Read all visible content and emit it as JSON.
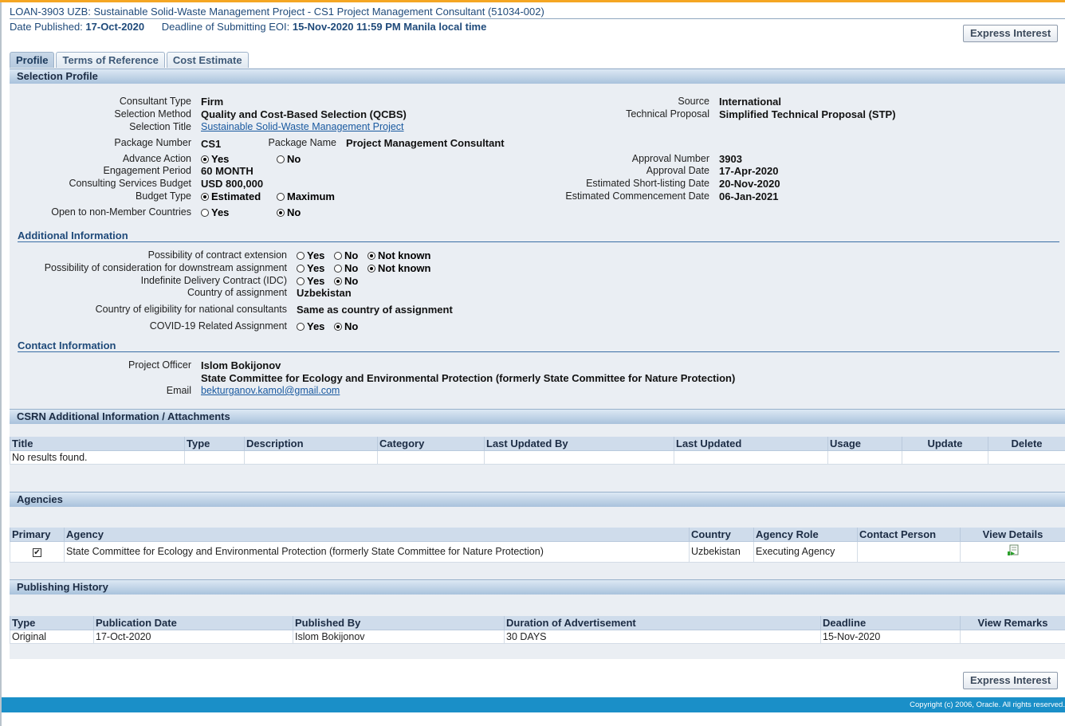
{
  "header": {
    "title": "LOAN-3903 UZB: Sustainable Solid-Waste Management Project - CS1 Project Management Consultant (51034-002)",
    "date_published_label": "Date Published:",
    "date_published": "17-Oct-2020",
    "deadline_label": "Deadline of Submitting EOI:",
    "deadline": "15-Nov-2020 11:59 PM Manila local time",
    "express_interest": "Express Interest"
  },
  "tabs": [
    "Profile",
    "Terms of Reference",
    "Cost Estimate"
  ],
  "selection_profile": {
    "heading": "Selection Profile",
    "consultant_type_label": "Consultant Type",
    "consultant_type": "Firm",
    "selection_method_label": "Selection Method",
    "selection_method": "Quality and Cost-Based Selection (QCBS)",
    "selection_title_label": "Selection Title",
    "selection_title": "Sustainable Solid-Waste Management Project",
    "package_number_label": "Package Number",
    "package_number": "CS1",
    "package_name_label": "Package Name",
    "package_name": "Project Management Consultant",
    "advance_action_label": "Advance Action",
    "yes": "Yes",
    "no": "No",
    "engagement_period_label": "Engagement Period",
    "engagement_period": "60 MONTH",
    "budget_label": "Consulting Services Budget",
    "budget": "USD 800,000",
    "budget_type_label": "Budget Type",
    "estimated": "Estimated",
    "maximum": "Maximum",
    "open_label": "Open to non-Member Countries",
    "source_label": "Source",
    "source": "International",
    "technical_proposal_label": "Technical Proposal",
    "technical_proposal": "Simplified Technical Proposal (STP)",
    "approval_number_label": "Approval Number",
    "approval_number": "3903",
    "approval_date_label": "Approval Date",
    "approval_date": "17-Apr-2020",
    "shortlisting_label": "Estimated Short-listing Date",
    "shortlisting_date": "20-Nov-2020",
    "commencement_label": "Estimated Commencement Date",
    "commencement_date": "06-Jan-2021"
  },
  "additional_info": {
    "heading": "Additional Information",
    "extension_label": "Possibility of contract extension",
    "downstream_label": "Possibility of consideration for downstream assignment",
    "idc_label": "Indefinite Delivery Contract (IDC)",
    "country_label": "Country of assignment",
    "country": "Uzbekistan",
    "eligibility_label": "Country of eligibility for national consultants",
    "eligibility": "Same as country of assignment",
    "covid_label": "COVID-19 Related Assignment",
    "yes": "Yes",
    "no": "No",
    "not_known": "Not known"
  },
  "contact_info": {
    "heading": "Contact Information",
    "officer_label": "Project Officer",
    "officer": "Islom Bokijonov",
    "organization": "State Committee for Ecology and Environmental Protection (formerly State Committee for Nature Protection)",
    "email_label": "Email",
    "email": "bekturganov.kamol@gmail.com"
  },
  "attachments": {
    "heading": "CSRN Additional Information / Attachments",
    "columns": [
      "Title",
      "Type",
      "Description",
      "Category",
      "Last Updated By",
      "Last Updated",
      "Usage",
      "Update",
      "Delete"
    ],
    "empty": "No results found."
  },
  "agencies": {
    "heading": "Agencies",
    "columns": [
      "Primary",
      "Agency",
      "Country",
      "Agency Role",
      "Contact Person",
      "View Details"
    ],
    "rows": [
      {
        "primary": "✔",
        "agency": "State Committee for Ecology and Environmental Protection (formerly State Committee for Nature Protection)",
        "country": "Uzbekistan",
        "role": "Executing Agency",
        "contact": "",
        "view_icon": "view-details-icon"
      }
    ]
  },
  "publishing_history": {
    "heading": "Publishing History",
    "columns": [
      "Type",
      "Publication Date",
      "Published By",
      "Duration of Advertisement",
      "Deadline",
      "View Remarks"
    ],
    "rows": [
      {
        "type": "Original",
        "date": "17-Oct-2020",
        "by": "Islom Bokijonov",
        "duration": "30 DAYS",
        "deadline": "15-Nov-2020",
        "remarks": ""
      }
    ]
  },
  "footer": {
    "copyright": "Copyright (c) 2006, Oracle. All rights reserved."
  },
  "colors": {
    "accent": "#f5a623",
    "footer": "#1a8fc8",
    "link": "#1a5aa0",
    "section": "#a9c2dc"
  }
}
